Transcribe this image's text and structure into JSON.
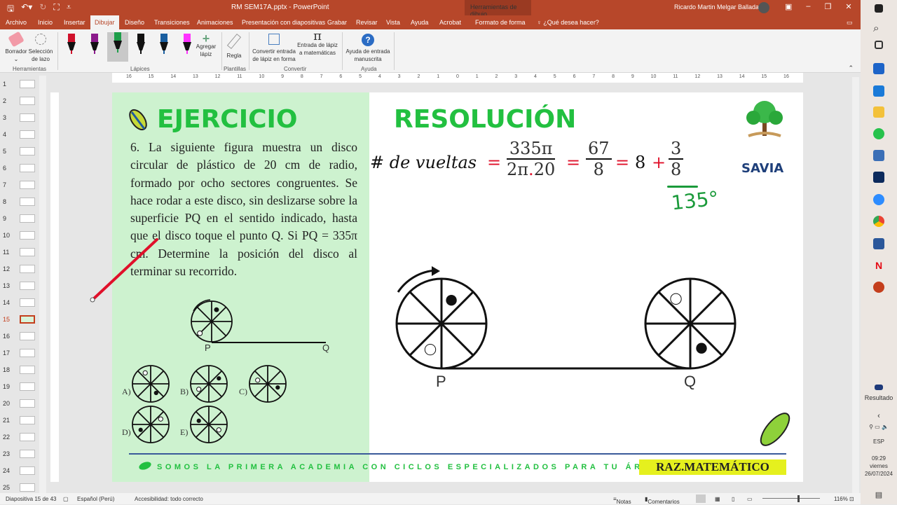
{
  "window": {
    "doc_title": "RM SEM17A.pptx  -  PowerPoint",
    "context_title": "Herramientas de dibujo",
    "user": "Ricardo Martin Melgar Balladares"
  },
  "tabs": [
    "Archivo",
    "Inicio",
    "Insertar",
    "Dibujar",
    "Diseño",
    "Transiciones",
    "Animaciones",
    "Presentación con diapositivas",
    "Grabar",
    "Revisar",
    "Vista",
    "Ayuda",
    "Acrobat",
    "Formato de forma"
  ],
  "active_tab": "Dibujar",
  "tell_me": "¿Qué desea hacer?",
  "ribbon": {
    "borrador": "Borrador",
    "seleccion": "Selección de lazo",
    "herramientas": "Herramientas",
    "agregar": "Agregar lápiz",
    "lapices": "Lápices",
    "regla": "Regla",
    "plantillas": "Plantillas",
    "convertir_forma": "Convertir entrada de lápiz en forma",
    "convertir_mat": "Entrada de lápiz a matemáticas",
    "convertir": "Convertir",
    "ayuda_entrada": "Ayuda de entrada manuscrita",
    "ayuda": "Ayuda",
    "pen_colors": [
      "#d0112b",
      "#8b1a8b",
      "#1e9e4a",
      "#111111",
      "#1a5fa0",
      "#ff33ff"
    ]
  },
  "ruler_ticks": [
    "16",
    "15",
    "14",
    "13",
    "12",
    "11",
    "10",
    "9",
    "8",
    "7",
    "6",
    "5",
    "4",
    "3",
    "2",
    "1",
    "0",
    "1",
    "2",
    "3",
    "4",
    "5",
    "6",
    "7",
    "8",
    "9",
    "10",
    "11",
    "12",
    "13",
    "14",
    "15",
    "16"
  ],
  "thumbnails": [
    "1",
    "2",
    "3",
    "4",
    "5",
    "6",
    "7",
    "8",
    "9",
    "10",
    "11",
    "12",
    "13",
    "14",
    "15",
    "16",
    "17",
    "18",
    "19",
    "20",
    "21",
    "22",
    "23",
    "24",
    "25"
  ],
  "active_slide": "15",
  "slide": {
    "ejercicio": "EJERCICIO",
    "resolucion": "RESOLUCIÓN",
    "problem": "6. La siguiente figura muestra un disco circular de plástico de 20 cm de radio, formado por ocho sectores congruentes. Se hace rodar a este disco, sin deslizarse sobre la superficie PQ en el sentido indicado, hasta que el disco toque el punto Q. Si PQ = 335π cm. Determine la posición del disco al terminar su recorrido.",
    "labels": {
      "p": "P",
      "q": "Q"
    },
    "options": [
      "A)",
      "B)",
      "C)",
      "D)",
      "E)"
    ],
    "math": {
      "lhs": "# de vueltas",
      "eq": "=",
      "f1_num": "335π",
      "f1_den_a": "2π",
      "f1_den_dot": ".",
      "f1_den_b": "20",
      "f2_num": "67",
      "f2_den": "8",
      "whole": "8",
      "plus": "+",
      "f3_num": "3",
      "f3_den": "8",
      "handwritten": "135°"
    },
    "logo": "SAVIA",
    "tagline": "SOMOS LA PRIMERA ACADEMIA CON CICLOS ESPECIALIZADOS PARA TU ÁREA",
    "subject": "RAZ.MATEMÁTICO",
    "colors": {
      "green": "#22c040",
      "panel": "#cdf2cf",
      "ink": "#e0102a"
    }
  },
  "status": {
    "slide": "Diapositiva 15 de 43",
    "lang": "Español (Perú)",
    "accessibility": "Accesibilidad: todo correcto",
    "notes": "Notas",
    "comments": "Comentarios",
    "zoom": "116%"
  },
  "taskbar": {
    "result": "Resultado",
    "lang": "ESP",
    "time": "09:29",
    "day": "viernes",
    "date": "26/07/2024"
  }
}
